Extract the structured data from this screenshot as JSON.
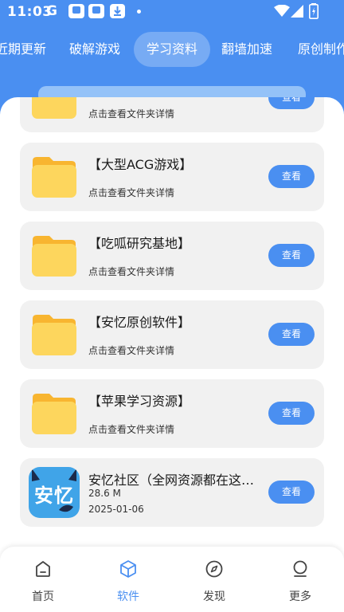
{
  "status_bar": {
    "time": "11:03",
    "g_letter": "G"
  },
  "tabs": [
    {
      "label": "近期更新"
    },
    {
      "label": "破解游戏"
    },
    {
      "label": "学习资料",
      "active": true
    },
    {
      "label": "翻墙加速"
    },
    {
      "label": "原创制作"
    }
  ],
  "folders": [
    {
      "title": "",
      "subtitle": "点击查看文件夹详情",
      "button": "查看"
    },
    {
      "title": "【大型ACG游戏】",
      "subtitle": "点击查看文件夹详情",
      "button": "查看"
    },
    {
      "title": "【吃呱研究基地】",
      "subtitle": "点击查看文件夹详情",
      "button": "查看"
    },
    {
      "title": "【安忆原创软件】",
      "subtitle": "点击查看文件夹详情",
      "button": "查看"
    },
    {
      "title": "【苹果学习资源】",
      "subtitle": "点击查看文件夹详情",
      "button": "查看"
    }
  ],
  "app_item": {
    "logo_text": "安忆",
    "title": "安忆社区（全网资源都在这里）",
    "size": "28.6 M",
    "date": "2025-01-06",
    "button": "查看"
  },
  "bottom_nav": [
    {
      "label": "首页",
      "icon": "home-icon"
    },
    {
      "label": "软件",
      "icon": "cube-icon",
      "active": true
    },
    {
      "label": "发现",
      "icon": "compass-icon"
    },
    {
      "label": "更多",
      "icon": "profile-icon"
    }
  ],
  "colors": {
    "accent": "#4a8ff1",
    "card_bg": "#f1f1f1",
    "folder_yellow": "#fdd65d"
  }
}
